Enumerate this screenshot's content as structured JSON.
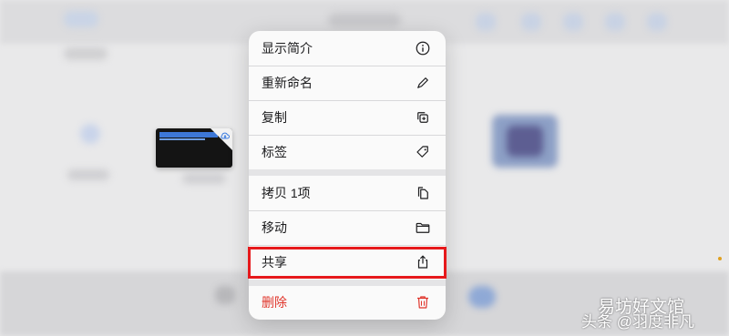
{
  "menu": {
    "items": [
      {
        "label": "显示简介",
        "icon": "info-icon"
      },
      {
        "label": "重新命名",
        "icon": "pencil-icon"
      },
      {
        "label": "复制",
        "icon": "duplicate-icon"
      },
      {
        "label": "标签",
        "icon": "tag-icon"
      },
      {
        "label": "拷贝 1项",
        "icon": "copy-doc-icon"
      },
      {
        "label": "移动",
        "icon": "folder-icon"
      },
      {
        "label": "共享",
        "icon": "share-icon"
      },
      {
        "label": "删除",
        "icon": "trash-icon"
      }
    ]
  },
  "colors": {
    "highlight": "#e6191c",
    "danger": "#e0352b"
  },
  "watermark": {
    "line1": "易坊好文馆",
    "line2": "头条 @羽度非凡"
  }
}
